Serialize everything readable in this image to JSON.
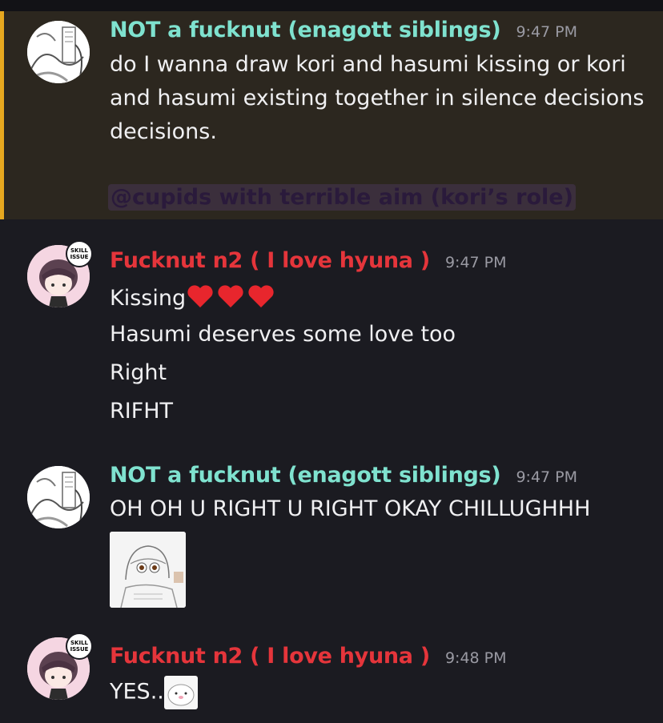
{
  "messages": [
    {
      "author": "NOT a fucknut (enagott siblings)",
      "time": "9:47 PM",
      "text": "do I wanna draw kori and hasumi kissing or kori and hasumi existing together in silence decisions decisions.",
      "mention": "@cupids with terrible aim (kori’s role)",
      "avatar_icon": "manga-avatar-icon"
    },
    {
      "author": "Fucknut n2 ( I love hyuna )",
      "time": "9:47 PM",
      "lines": [
        "Kissing",
        "Hasumi deserves some love too",
        "Right",
        "RIFHT"
      ],
      "avatar_icon": "chibi-avatar-icon",
      "badge": "SKILL ISSUE"
    },
    {
      "author": "NOT a fucknut (enagott siblings)",
      "time": "9:47 PM",
      "text": "OH OH U RIGHT U RIGHT OKAY CHILLUGHHH",
      "attachment_icon": "sketch-attachment-icon"
    },
    {
      "author": "Fucknut n2 ( I love hyuna )",
      "time": "9:48 PM",
      "text": "YES..",
      "badge": "SKILL ISSUE"
    }
  ],
  "colors": {
    "background": "#1b1b21",
    "mention_highlight": "#2c271f",
    "mention_bar": "#e6a81f",
    "author_teal": "#7fe2cf",
    "author_red": "#e5353b"
  }
}
